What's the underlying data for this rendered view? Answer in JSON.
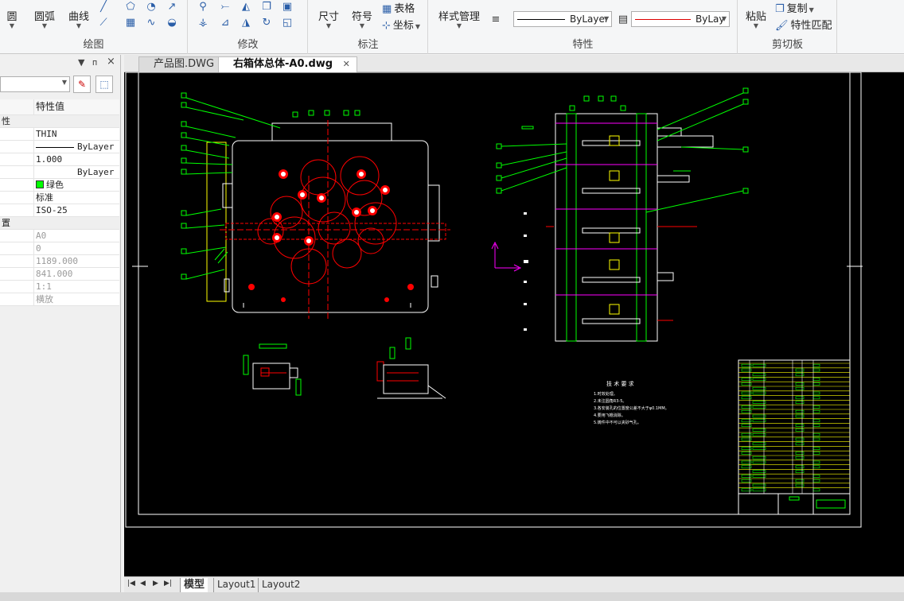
{
  "ribbon": {
    "draw": {
      "title": "绘图",
      "circle_label": "圆",
      "arc_label": "圆弧",
      "polyline_label": "曲线"
    },
    "modify": {
      "title": "修改"
    },
    "annotate": {
      "title": "标注",
      "dimension_label": "尺寸",
      "symbol_label": "符号",
      "table_label": "表格",
      "coordinate_label": "坐标"
    },
    "properties": {
      "title": "特性",
      "style_manager_label": "样式管理",
      "linetype_value": "ByLayer",
      "color_value": "ByLay"
    },
    "clipboard": {
      "title": "剪切板",
      "paste_label": "粘贴",
      "copy_label": "复制",
      "match_label": "特性匹配"
    }
  },
  "props_panel": {
    "pin_glyph": "ᴨ",
    "close_glyph": "×",
    "header_value_col": "特性值",
    "rows": [
      {
        "key": "性",
        "value": "",
        "kind": "cat"
      },
      {
        "key": "",
        "value": "THIN",
        "kind": "normal"
      },
      {
        "key": "",
        "value": "ByLayer",
        "kind": "linetype"
      },
      {
        "key": "",
        "value": "1.000",
        "kind": "normal"
      },
      {
        "key": "",
        "value": "ByLayer",
        "kind": "lineweight"
      },
      {
        "key": "",
        "value": "绿色",
        "kind": "color"
      },
      {
        "key": "",
        "value": "标准",
        "kind": "normal"
      },
      {
        "key": "",
        "value": "ISO-25",
        "kind": "normal"
      },
      {
        "key": "置",
        "value": "",
        "kind": "cat"
      },
      {
        "key": "",
        "value": "A0",
        "kind": "grey"
      },
      {
        "key": "",
        "value": "0",
        "kind": "grey"
      },
      {
        "key": "",
        "value": "1189.000",
        "kind": "grey"
      },
      {
        "key": "",
        "value": "841.000",
        "kind": "grey"
      },
      {
        "key": "",
        "value": "1:1",
        "kind": "grey"
      },
      {
        "key": "",
        "value": "横放",
        "kind": "grey"
      }
    ]
  },
  "doc_tabs": [
    {
      "label": "产品图.DWG",
      "active": false
    },
    {
      "label": "右箱体总体-A0.dwg",
      "active": true
    }
  ],
  "drawing": {
    "tech_req_title": "技 术 要 求",
    "tech_req_lines": [
      "1.时效处理。",
      "2.未注圆角R3-5。",
      "3.各安装孔的位置度公差不大于φ0.1MM。",
      "4.要用飞檐消除。",
      "5.铸件中不可以夹砂气孔。"
    ]
  },
  "layout_tabs": {
    "nav": [
      "|◀",
      "◀",
      "▶",
      "▶|"
    ],
    "tabs": [
      {
        "label": "模型",
        "active": true
      },
      {
        "label": "Layout1",
        "active": false
      },
      {
        "label": "Layout2",
        "active": false
      }
    ]
  },
  "colors": {
    "canvas_bg": "#000000",
    "cad_white": "#ffffff",
    "cad_green": "#00ff00",
    "cad_red": "#ff0000",
    "cad_yellow": "#ffff00",
    "cad_magenta": "#ff00ff"
  }
}
